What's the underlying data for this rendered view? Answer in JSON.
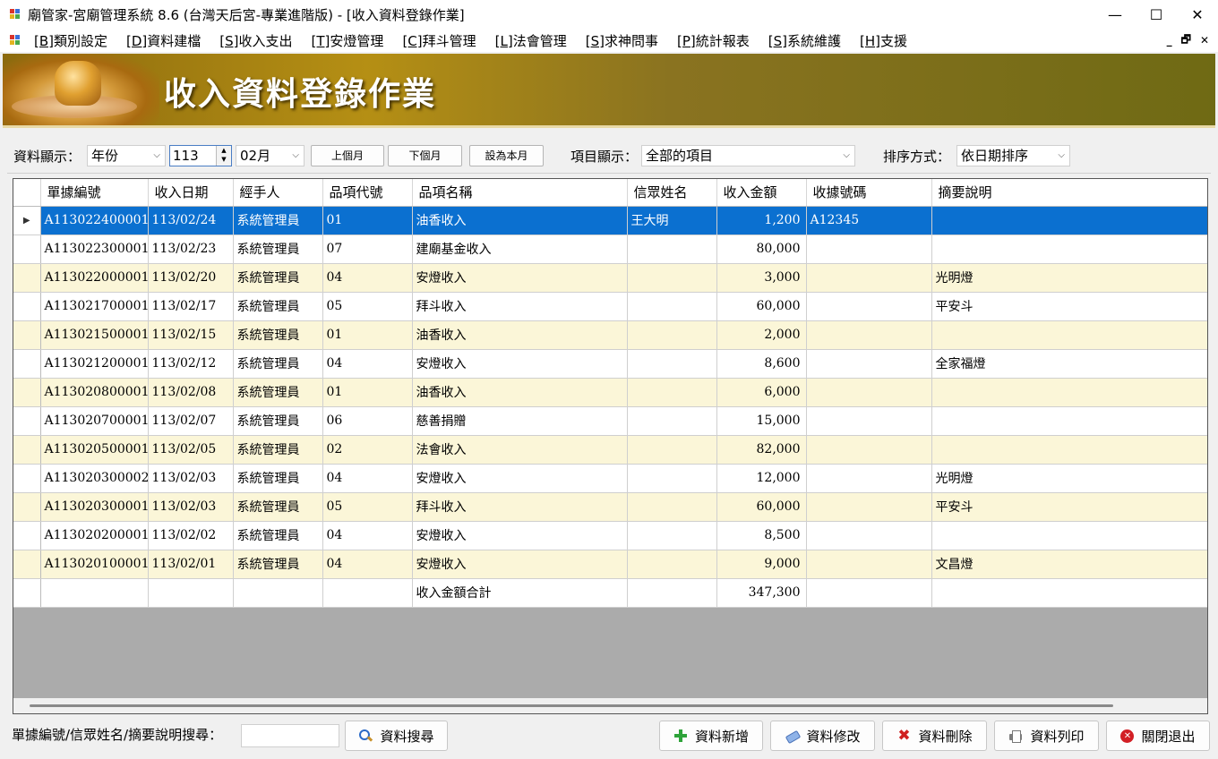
{
  "window": {
    "title": "廟管家-宮廟管理系統 8.6 (台灣天后宮-專業進階版) - [收入資料登錄作業]",
    "minimize_glyph": "—",
    "maximize_glyph": "☐",
    "close_glyph": "✕"
  },
  "menu": {
    "items": [
      {
        "key": "[B]",
        "label": "類別設定"
      },
      {
        "key": "[D]",
        "label": "資料建檔"
      },
      {
        "key": "[S]",
        "label": "收入支出"
      },
      {
        "key": "[T]",
        "label": "安燈管理"
      },
      {
        "key": "[C]",
        "label": "拜斗管理"
      },
      {
        "key": "[L]",
        "label": "法會管理"
      },
      {
        "key": "[S]",
        "label": "求神問事"
      },
      {
        "key": "[P]",
        "label": "統計報表"
      },
      {
        "key": "[S]",
        "label": "系統維護"
      },
      {
        "key": "[H]",
        "label": "支援"
      }
    ],
    "mdi_minimize": "_",
    "mdi_restore": "🗗",
    "mdi_close": "✕"
  },
  "banner": {
    "title": "收入資料登錄作業"
  },
  "filters": {
    "display_label": "資料顯示：",
    "period_type": "年份",
    "year": "113",
    "month": "02月",
    "prev_month_button": "上個月",
    "next_month_button": "下個月",
    "this_month_button": "設為本月",
    "item_label": "項目顯示：",
    "item_value": "全部的項目",
    "sort_label": "排序方式：",
    "sort_value": "依日期排序"
  },
  "table": {
    "columns": [
      "單據編號",
      "收入日期",
      "經手人",
      "品項代號",
      "品項名稱",
      "信眾姓名",
      "收入金額",
      "收據號碼",
      "摘要說明"
    ],
    "rows": [
      {
        "id": "A113022400001",
        "date": "113/02/24",
        "handler": "系統管理員",
        "code": "01",
        "name": "油香收入",
        "donor": "王大明",
        "amount": "1,200",
        "receipt": "A12345",
        "note": ""
      },
      {
        "id": "A113022300001",
        "date": "113/02/23",
        "handler": "系統管理員",
        "code": "07",
        "name": "建廟基金收入",
        "donor": "",
        "amount": "80,000",
        "receipt": "",
        "note": ""
      },
      {
        "id": "A113022000001",
        "date": "113/02/20",
        "handler": "系統管理員",
        "code": "04",
        "name": "安燈收入",
        "donor": "",
        "amount": "3,000",
        "receipt": "",
        "note": "光明燈"
      },
      {
        "id": "A113021700001",
        "date": "113/02/17",
        "handler": "系統管理員",
        "code": "05",
        "name": "拜斗收入",
        "donor": "",
        "amount": "60,000",
        "receipt": "",
        "note": "平安斗"
      },
      {
        "id": "A113021500001",
        "date": "113/02/15",
        "handler": "系統管理員",
        "code": "01",
        "name": "油香收入",
        "donor": "",
        "amount": "2,000",
        "receipt": "",
        "note": ""
      },
      {
        "id": "A113021200001",
        "date": "113/02/12",
        "handler": "系統管理員",
        "code": "04",
        "name": "安燈收入",
        "donor": "",
        "amount": "8,600",
        "receipt": "",
        "note": "全家福燈"
      },
      {
        "id": "A113020800001",
        "date": "113/02/08",
        "handler": "系統管理員",
        "code": "01",
        "name": "油香收入",
        "donor": "",
        "amount": "6,000",
        "receipt": "",
        "note": ""
      },
      {
        "id": "A113020700001",
        "date": "113/02/07",
        "handler": "系統管理員",
        "code": "06",
        "name": "慈善捐贈",
        "donor": "",
        "amount": "15,000",
        "receipt": "",
        "note": ""
      },
      {
        "id": "A113020500001",
        "date": "113/02/05",
        "handler": "系統管理員",
        "code": "02",
        "name": "法會收入",
        "donor": "",
        "amount": "82,000",
        "receipt": "",
        "note": ""
      },
      {
        "id": "A113020300002",
        "date": "113/02/03",
        "handler": "系統管理員",
        "code": "04",
        "name": "安燈收入",
        "donor": "",
        "amount": "12,000",
        "receipt": "",
        "note": "光明燈"
      },
      {
        "id": "A113020300001",
        "date": "113/02/03",
        "handler": "系統管理員",
        "code": "05",
        "name": "拜斗收入",
        "donor": "",
        "amount": "60,000",
        "receipt": "",
        "note": "平安斗"
      },
      {
        "id": "A113020200001",
        "date": "113/02/02",
        "handler": "系統管理員",
        "code": "04",
        "name": "安燈收入",
        "donor": "",
        "amount": "8,500",
        "receipt": "",
        "note": ""
      },
      {
        "id": "A113020100001",
        "date": "113/02/01",
        "handler": "系統管理員",
        "code": "04",
        "name": "安燈收入",
        "donor": "",
        "amount": "9,000",
        "receipt": "",
        "note": "文昌燈"
      }
    ],
    "total_label": "收入金額合計",
    "total_amount": "347,300",
    "selected_marker": "▶"
  },
  "bottom": {
    "search_label": "單據編號/信眾姓名/摘要說明搜尋：",
    "search_value": "",
    "search_button": "資料搜尋",
    "add_button": "資料新增",
    "edit_button": "資料修改",
    "delete_button": "資料刪除",
    "print_button": "資料列印",
    "exit_button": "關閉退出"
  },
  "colors": {
    "selected_row": "#0b70d0",
    "alt_row": "#fbf6d8",
    "banner_gold": "#b58f14"
  }
}
